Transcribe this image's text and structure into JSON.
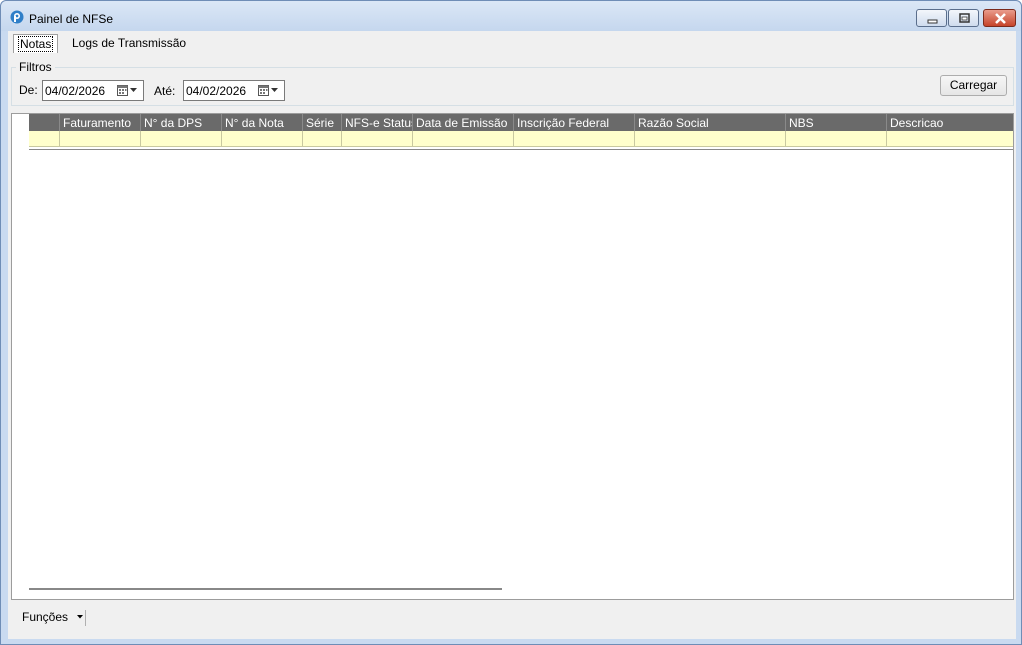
{
  "window": {
    "title": "Painel de NFSe"
  },
  "tabs": [
    {
      "label": "Notas",
      "active": true
    },
    {
      "label": "Logs de Transmissão",
      "active": false
    }
  ],
  "filters": {
    "legend": "Filtros",
    "from_label": "De:",
    "from_value": "04/02/2026",
    "to_label": "Até:",
    "to_value": "04/02/2026",
    "load_button": "Carregar"
  },
  "grid": {
    "columns": [
      "Faturamento",
      "N° da DPS",
      "N° da Nota",
      "Série",
      "NFS-e Status",
      "Data de Emissão",
      "Inscrição Federal",
      "Razão Social",
      "NBS",
      "Descricao"
    ]
  },
  "bottom": {
    "functions_label": "Funções"
  },
  "colors": {
    "header_bg": "#6a6a6a",
    "row_bg": "#ffffcc",
    "accent": "#1a62b0"
  }
}
